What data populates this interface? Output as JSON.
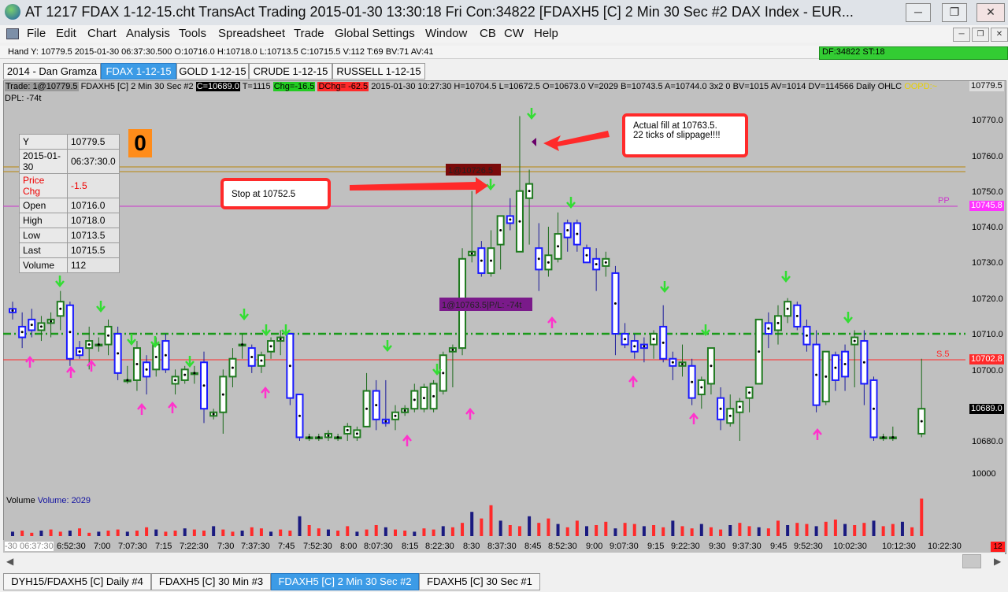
{
  "window": {
    "title": "AT 1217 FDAX 1-12-15.cht  TransAct Trading 2015-01-30  13:30:18 Fri  Con:34822  [FDAXH5 [C]  2 Min 30 Sec  #2  DAX Index - EUR...",
    "controls": {
      "minimize": "─",
      "restore": "❐",
      "close": "✕"
    }
  },
  "menu": [
    "File",
    "Edit",
    "Chart",
    "Analysis",
    "Tools",
    "Spreadsheet",
    "Trade",
    "Global Settings",
    "Window",
    "CB",
    "CW",
    "Help"
  ],
  "mdi_controls": {
    "minimize": "─",
    "restore": "❐",
    "close": "✕"
  },
  "hand_line": "Hand Y: 10779.5  2015-01-30  06:37:30.500  O:10716.0  H:10718.0  L:10713.5  C:10715.5  V:112  T:69  BV:71  AV:41",
  "df_status": "DF:34822  ST:18",
  "tabs": [
    "2014 - Dan Gramza",
    "FDAX 1-12-15",
    "GOLD 1-12-15",
    "CRUDE 1-12-15",
    "RUSSELL 1-12-15"
  ],
  "info": {
    "trade": "Trade: 1@10779.5",
    "symbol": "FDAXH5 [C]  2 Min 30 Sec   #2",
    "c": "C=10689.0",
    "t": "T=1115",
    "chg": "Chg=-16.5",
    "dchg": "DChg= -62.5",
    "rest": "2015-01-30  10:27:30  H=10704.5  L=10672.5  O=10673.0  V=2029  B=10743.5  A=10744.0  3x2 0  BV=1015  AV=1014  DV=114566   Daily OHLC",
    "oopd": "OOPD:~",
    "dpl": "DPL: -74t"
  },
  "quote": [
    {
      "label": "Y",
      "value": "10779.5"
    },
    {
      "label": "2015-01-30",
      "value": "06:37:30.0"
    },
    {
      "label": "Price Chg",
      "value": "-1.5"
    },
    {
      "label": "Open",
      "value": "10716.0"
    },
    {
      "label": "High",
      "value": "10718.0"
    },
    {
      "label": "Low",
      "value": "10713.5"
    },
    {
      "label": "Last",
      "value": "10715.5"
    },
    {
      "label": "Volume",
      "value": "112"
    }
  ],
  "position_box": "0",
  "callouts": {
    "fill": "Actual fill at 10763.5.\n22 ticks of slippage!!!!",
    "stop": "Stop at 10752.5"
  },
  "order_labels": {
    "entry": "1@10726.5",
    "pl": "1@10763.5|P/L: -74t"
  },
  "ref_lines": {
    "pp": "PP",
    "s5": "S.5"
  },
  "price_axis": {
    "ticks": [
      "10779.5",
      "10770.0",
      "10760.0",
      "10750.0",
      "10740.0",
      "10730.0",
      "10720.0",
      "10710.0",
      "10702.8",
      "10700.0",
      "10689.0",
      "10680.0",
      "10000"
    ],
    "pp_value": "10745.8",
    "s5_value": "10702.8",
    "last_value": "10689.0",
    "red_count": "12"
  },
  "volume": {
    "label": "Volume",
    "value": "Volume: 2029"
  },
  "time_axis": [
    "-30 06:37:30",
    "6:52:30",
    "7:00",
    "7:07:30",
    "7:15",
    "7:22:30",
    "7:30",
    "7:37:30",
    "7:45",
    "7:52:30",
    "8:00",
    "8:07:30",
    "8:15",
    "8:22:30",
    "8:30",
    "8:37:30",
    "8:45",
    "8:52:30",
    "9:00",
    "9:07:30",
    "9:15",
    "9:22:30",
    "9:30",
    "9:37:30",
    "9:45",
    "9:52:30",
    "10:02:30",
    "10:12:30",
    "10:22:30"
  ],
  "bottom_tabs": [
    "DYH15/FDAXH5 [C]  Daily  #4",
    "FDAXH5 [C]  30 Min  #3",
    "FDAXH5 [C]  2 Min 30 Sec  #2",
    "FDAXH5 [C]  30 Sec  #1"
  ],
  "colors": {
    "chart_bg": "#c0c0c0",
    "up_candle": "#1f7a1f",
    "down_candle": "#1a1aff",
    "pivot_line": "#cc33cc",
    "s5_line": "#ff2a2a",
    "green_dashed": "#1a9a1a",
    "arrow_green": "#33dd33",
    "arrow_magenta": "#ff33cc",
    "callout_red": "#ff2a2a"
  }
}
